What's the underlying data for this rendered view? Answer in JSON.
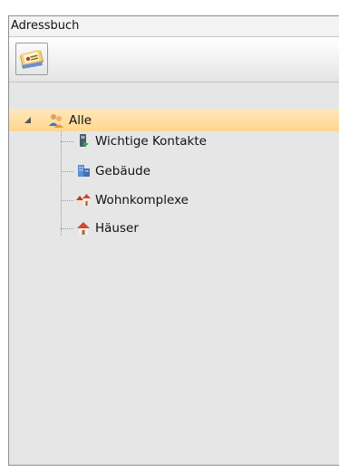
{
  "panel": {
    "title": "Adressbuch"
  },
  "toolbar": {
    "address_book_icon": "address-book-icon"
  },
  "tree": {
    "root": {
      "label": "Alle",
      "icon": "people-icon",
      "expanded": true,
      "selected": true
    },
    "children": [
      {
        "label": "Wichtige Kontakte",
        "icon": "important-contacts-icon"
      },
      {
        "label": "Gebäude",
        "icon": "building-icon"
      },
      {
        "label": "Wohnkomplexe",
        "icon": "housing-complex-icon"
      },
      {
        "label": "Häuser",
        "icon": "house-icon"
      }
    ]
  },
  "colors": {
    "selection": "#ffd68f",
    "panel_background": "#e6e6e6",
    "border": "#8f8f8f"
  }
}
